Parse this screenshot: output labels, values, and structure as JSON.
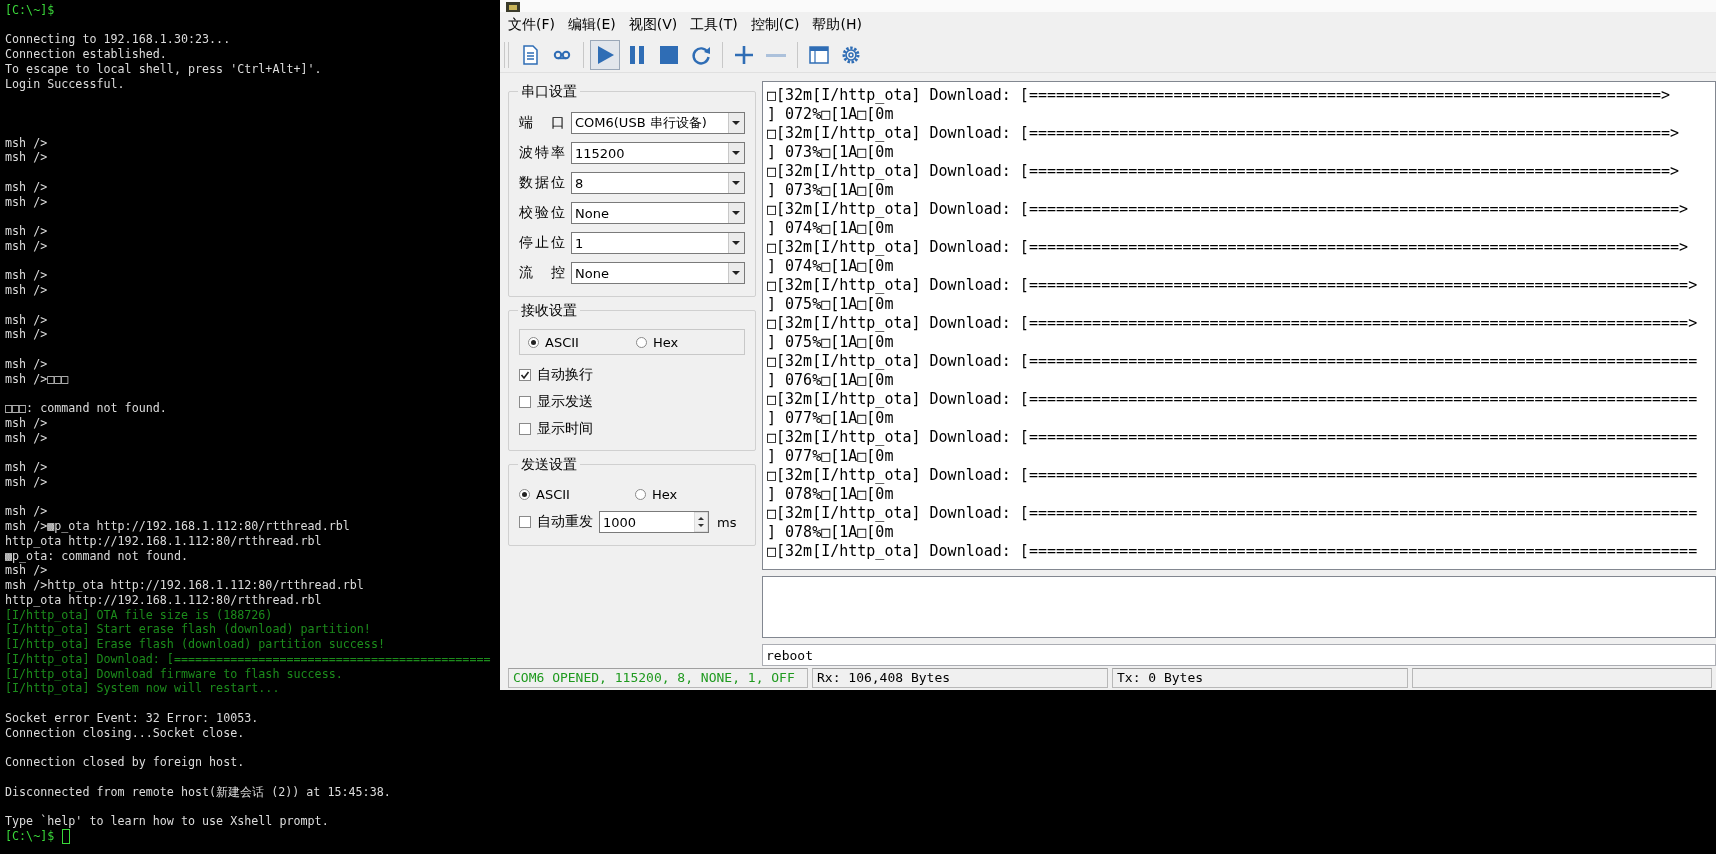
{
  "terminal": {
    "cursor": true,
    "lines": [
      {
        "kind": "prompt",
        "text": "[C:\\~]$"
      },
      {
        "kind": "blank"
      },
      {
        "kind": "text",
        "text": "Connecting to 192.168.1.30:23..."
      },
      {
        "kind": "text",
        "text": "Connection established."
      },
      {
        "kind": "text",
        "text": "To escape to local shell, press 'Ctrl+Alt+]'."
      },
      {
        "kind": "text",
        "text": "Login Successful."
      },
      {
        "kind": "blank"
      },
      {
        "kind": "blank"
      },
      {
        "kind": "blank"
      },
      {
        "kind": "text",
        "text": "msh />"
      },
      {
        "kind": "text",
        "text": "msh />"
      },
      {
        "kind": "blank"
      },
      {
        "kind": "text",
        "text": "msh />"
      },
      {
        "kind": "text",
        "text": "msh />"
      },
      {
        "kind": "blank"
      },
      {
        "kind": "text",
        "text": "msh />"
      },
      {
        "kind": "text",
        "text": "msh />"
      },
      {
        "kind": "blank"
      },
      {
        "kind": "text",
        "text": "msh />"
      },
      {
        "kind": "text",
        "text": "msh />"
      },
      {
        "kind": "blank"
      },
      {
        "kind": "text",
        "text": "msh />"
      },
      {
        "kind": "text",
        "text": "msh />"
      },
      {
        "kind": "blank"
      },
      {
        "kind": "text",
        "text": "msh />"
      },
      {
        "kind": "text",
        "text": "msh />□□□"
      },
      {
        "kind": "blank"
      },
      {
        "kind": "text",
        "text": "□□□: command not found."
      },
      {
        "kind": "text",
        "text": "msh />"
      },
      {
        "kind": "text",
        "text": "msh />"
      },
      {
        "kind": "blank"
      },
      {
        "kind": "text",
        "text": "msh />"
      },
      {
        "kind": "text",
        "text": "msh />"
      },
      {
        "kind": "blank"
      },
      {
        "kind": "text",
        "text": "msh />"
      },
      {
        "kind": "text",
        "text": "msh />▩p_ota http://192.168.1.112:80/rtthread.rbl"
      },
      {
        "kind": "text",
        "text": "http_ota http://192.168.1.112:80/rtthread.rbl"
      },
      {
        "kind": "text",
        "text": "▩p_ota: command not found."
      },
      {
        "kind": "text",
        "text": "msh />"
      },
      {
        "kind": "text",
        "text": "msh />http_ota http://192.168.1.112:80/rtthread.rbl"
      },
      {
        "kind": "text",
        "text": "http_ota http://192.168.1.112:80/rtthread.rbl"
      },
      {
        "kind": "info",
        "text": "[I/http_ota] OTA file size is (188726)"
      },
      {
        "kind": "info",
        "text": "[I/http_ota] Start erase flash (download) partition!"
      },
      {
        "kind": "info",
        "text": "[I/http_ota] Erase flash (download) partition success!"
      },
      {
        "kind": "info",
        "text": "[I/http_ota] Download: [============================================="
      },
      {
        "kind": "info",
        "text": "[I/http_ota] Download firmware to flash success."
      },
      {
        "kind": "info",
        "text": "[I/http_ota] System now will restart..."
      },
      {
        "kind": "blank"
      },
      {
        "kind": "text",
        "text": "Socket error Event: 32 Error: 10053."
      },
      {
        "kind": "text",
        "text": "Connection closing...Socket close."
      },
      {
        "kind": "blank"
      },
      {
        "kind": "text",
        "text": "Connection closed by foreign host."
      },
      {
        "kind": "blank"
      },
      {
        "kind": "text",
        "text": "Disconnected from remote host(新建会话 (2)) at 15:45:38."
      },
      {
        "kind": "blank"
      },
      {
        "kind": "text",
        "text": "Type `help' to learn how to use Xshell prompt."
      },
      {
        "kind": "prompt",
        "text": "[C:\\~]$"
      }
    ]
  },
  "serial_window": {
    "menu": [
      "文件(F)",
      "编辑(E)",
      "视图(V)",
      "工具(T)",
      "控制(C)",
      "帮助(H)"
    ],
    "toolbar": [
      {
        "kind": "document",
        "pressed": false,
        "disabled": false
      },
      {
        "kind": "tape",
        "pressed": false,
        "disabled": false
      },
      {
        "kind": "separator"
      },
      {
        "kind": "play",
        "pressed": true,
        "disabled": false
      },
      {
        "kind": "pause",
        "pressed": false,
        "disabled": false
      },
      {
        "kind": "stop",
        "pressed": false,
        "disabled": false
      },
      {
        "kind": "refresh",
        "pressed": false,
        "disabled": false
      },
      {
        "kind": "separator"
      },
      {
        "kind": "plus",
        "pressed": false,
        "disabled": false
      },
      {
        "kind": "minus",
        "pressed": false,
        "disabled": true
      },
      {
        "kind": "separator"
      },
      {
        "kind": "window",
        "pressed": false,
        "disabled": false
      },
      {
        "kind": "gear",
        "pressed": false,
        "disabled": false
      }
    ],
    "port_settings": {
      "title": "串口设置",
      "fields": [
        {
          "label": "端 口",
          "value": "COM6(USB 串行设备)"
        },
        {
          "label": "波特率",
          "value": "115200"
        },
        {
          "label": "数据位",
          "value": "8"
        },
        {
          "label": "校验位",
          "value": "None"
        },
        {
          "label": "停止位",
          "value": "1"
        },
        {
          "label": "流 控",
          "value": "None"
        }
      ]
    },
    "receive_settings": {
      "title": "接收设置",
      "encodings": [
        {
          "label": "ASCII",
          "selected": true
        },
        {
          "label": "Hex",
          "selected": false
        }
      ],
      "options": [
        {
          "label": "自动换行",
          "checked": true
        },
        {
          "label": "显示发送",
          "checked": false
        },
        {
          "label": "显示时间",
          "checked": false
        }
      ]
    },
    "send_settings": {
      "title": "发送设置",
      "encodings": [
        {
          "label": "ASCII",
          "selected": true
        },
        {
          "label": "Hex",
          "selected": false
        }
      ],
      "auto_resend": {
        "label": "自动重发",
        "checked": false,
        "value": "1000",
        "unit": "ms"
      }
    },
    "output_lines": [
      "□[32m[I/http_ota] Download: [======================================================================>",
      "] 072%□[1A□[0m",
      "□[32m[I/http_ota] Download: [=======================================================================>",
      "] 073%□[1A□[0m",
      "□[32m[I/http_ota] Download: [=======================================================================>",
      "] 073%□[1A□[0m",
      "□[32m[I/http_ota] Download: [========================================================================>",
      "] 074%□[1A□[0m",
      "□[32m[I/http_ota] Download: [========================================================================>",
      "] 074%□[1A□[0m",
      "□[32m[I/http_ota] Download: [=========================================================================>",
      "] 075%□[1A□[0m",
      "□[32m[I/http_ota] Download: [=========================================================================>",
      "] 075%□[1A□[0m",
      "□[32m[I/http_ota] Download: [==========================================================================",
      "] 076%□[1A□[0m",
      "□[32m[I/http_ota] Download: [==========================================================================",
      "] 077%□[1A□[0m",
      "□[32m[I/http_ota] Download: [==========================================================================",
      "] 077%□[1A□[0m",
      "□[32m[I/http_ota] Download: [==========================================================================",
      "] 078%□[1A□[0m",
      "□[32m[I/http_ota] Download: [==========================================================================",
      "] 078%□[1A□[0m",
      "□[32m[I/http_ota] Download: [=========================================================================="
    ],
    "send_input": "reboot",
    "status_bar": [
      {
        "kind": "connection",
        "text": "COM6 OPENED, 115200, 8, NONE, 1, OFF"
      },
      {
        "kind": "counter",
        "text": "Rx: 106,408 Bytes"
      },
      {
        "kind": "counter",
        "text": "Tx: 0 Bytes"
      }
    ]
  }
}
